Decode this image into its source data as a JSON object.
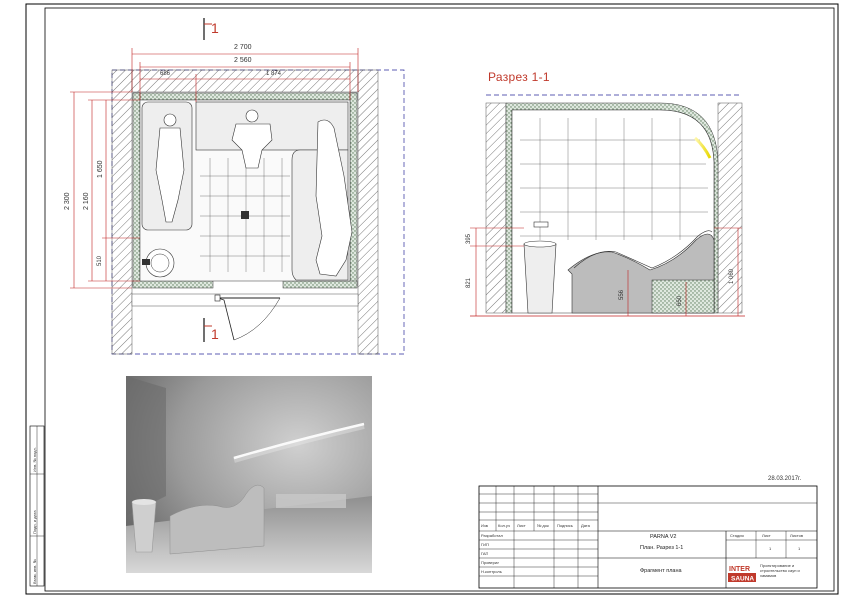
{
  "plan": {
    "cut_label_top": "1",
    "cut_label_bottom": "1",
    "dims": {
      "overall_width": "2 700",
      "inner_width": "2 560",
      "left_part": "686",
      "right_part": "1 874",
      "overall_height": "2 300",
      "inner_height": "2 160",
      "upper_part": "1 650",
      "lower_part": "510"
    }
  },
  "section": {
    "title": "Разрез 1-1",
    "dims": {
      "sink_h1": "395",
      "sink_h2": "821",
      "bench_h1": "556",
      "bench_h2": "650",
      "back_h": "1 060"
    }
  },
  "title_block": {
    "date": "28.03.2017г.",
    "project_name": "PARNA V2",
    "sheet_name": "План. Разрез 1-1",
    "drawing_type": "Фрагмент плана",
    "col_stage": "Стадия",
    "col_sheet": "Лист",
    "col_sheets": "Листов",
    "sheet_no": "1",
    "sheets_total": "1",
    "header_cells": [
      "Изм",
      "Кол.уч",
      "Лист",
      "№ док",
      "Подпись",
      "Дата"
    ],
    "role_rows": [
      "Разработал",
      "ГИП",
      "ГАП",
      "Проверил",
      "Н.контроль"
    ],
    "logo_top": "INTER",
    "logo_bottom": "SAUNA",
    "company_info": "Проектирование и строительство саун и хамамов"
  },
  "side_stamp": {
    "labels": [
      "Инв. № подл.",
      "Подп. и дата",
      "Взам. инв. №"
    ]
  }
}
